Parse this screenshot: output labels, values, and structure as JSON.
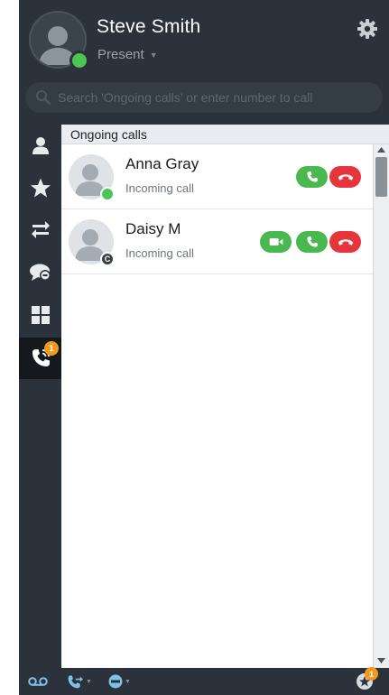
{
  "user": {
    "name": "Steve Smith",
    "status": "Present",
    "presence_color": "#4cc552"
  },
  "search": {
    "placeholder": "Search 'Ongoing calls' or enter number to call"
  },
  "sidebar": {
    "items": [
      {
        "icon": "contacts-icon"
      },
      {
        "icon": "favorites-star-icon"
      },
      {
        "icon": "transfer-arrows-icon"
      },
      {
        "icon": "chat-bubbles-icon"
      },
      {
        "icon": "apps-grid-icon"
      },
      {
        "icon": "phone-call-icon",
        "active": true,
        "badge": "1"
      }
    ]
  },
  "panel": {
    "title": "Ongoing calls"
  },
  "calls": [
    {
      "name": "Anna Gray",
      "status": "Incoming call",
      "presence": "available",
      "actions": [
        "answer",
        "decline"
      ]
    },
    {
      "name": "Daisy M",
      "status": "Incoming call",
      "presence": "C",
      "actions": [
        "video",
        "answer",
        "decline"
      ]
    }
  ],
  "bottom": {
    "items": [
      {
        "icon": "voicemail-icon"
      },
      {
        "icon": "call-forward-icon"
      },
      {
        "icon": "do-not-disturb-icon"
      }
    ],
    "notifications_badge": "1"
  },
  "colors": {
    "accent_green": "#48b84f",
    "decline_red": "#e8343b",
    "badge_orange": "#f39a1e",
    "background_dark": "#2b323b"
  }
}
